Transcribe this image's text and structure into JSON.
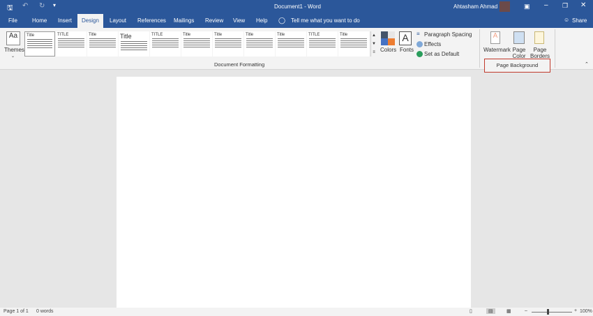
{
  "title_bar": {
    "document_title": "Document1  -  Word",
    "user_name": "Ahtasham Ahmad"
  },
  "tabs": [
    {
      "label": "File"
    },
    {
      "label": "Home"
    },
    {
      "label": "Insert"
    },
    {
      "label": "Design",
      "active": true
    },
    {
      "label": "Layout"
    },
    {
      "label": "References"
    },
    {
      "label": "Mailings"
    },
    {
      "label": "Review"
    },
    {
      "label": "View"
    },
    {
      "label": "Help"
    }
  ],
  "tell_me": "Tell me what you want to do",
  "share": "Share",
  "ribbon": {
    "themes": "Themes",
    "style_gallery": [
      "Title",
      "TITLE",
      "Title",
      "Title",
      "TITLE",
      "Title",
      "Title",
      "Title",
      "Title",
      "TITLE",
      "Title"
    ],
    "colors": "Colors",
    "fonts": "Fonts",
    "paragraph_spacing": "Paragraph Spacing",
    "effects": "Effects",
    "set_as_default": "Set as Default",
    "group_document_formatting": "Document Formatting",
    "watermark": "Watermark",
    "page_color": "Page Color",
    "page_borders": "Page Borders",
    "group_page_background": "Page Background",
    "highlight_color": "#c0392b"
  },
  "status": {
    "page": "Page 1 of 1",
    "words": "0 words",
    "zoom": "100%"
  },
  "colors": {
    "accent": "#2b579a"
  }
}
